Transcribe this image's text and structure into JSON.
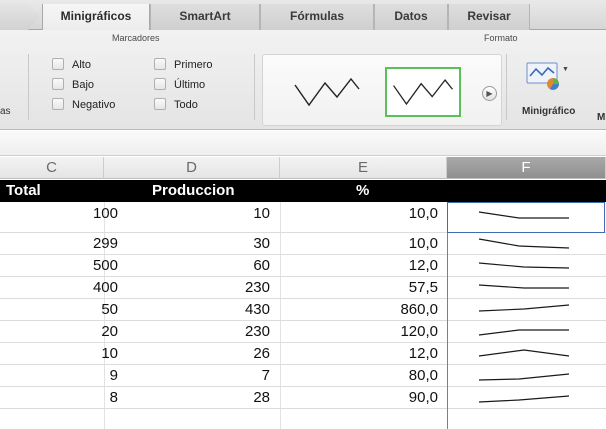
{
  "ribbon": {
    "tabs": [
      {
        "label": "Minigráficos",
        "active": true
      },
      {
        "label": "SmartArt",
        "active": false
      },
      {
        "label": "Fórmulas",
        "active": false
      },
      {
        "label": "Datos",
        "active": false
      },
      {
        "label": "Revisar",
        "active": false
      }
    ],
    "groups": {
      "markers": {
        "title": "Marcadores",
        "options": [
          {
            "label": "Alto",
            "checked": false
          },
          {
            "label": "Bajo",
            "checked": false
          },
          {
            "label": "Negativo",
            "checked": false
          },
          {
            "label": "Primero",
            "checked": false
          },
          {
            "label": "Último",
            "checked": false
          },
          {
            "label": "Todo",
            "checked": false
          }
        ]
      },
      "format": {
        "title": "Formato",
        "styles_selected_index": 1,
        "sparkline_button_label": "Minigráfico"
      }
    },
    "edge_left_fragment": "as",
    "edge_right_fragment": "M"
  },
  "sheet": {
    "columns": [
      "C",
      "D",
      "E",
      "F"
    ],
    "selected_column": "F",
    "header": {
      "total": "Total",
      "produccion": "Produccion",
      "percent": "%"
    },
    "rows": [
      {
        "total": "100",
        "produccion": "10",
        "percent": "10,0"
      },
      {
        "total": "299",
        "produccion": "30",
        "percent": "10,0"
      },
      {
        "total": "500",
        "produccion": "60",
        "percent": "12,0"
      },
      {
        "total": "400",
        "produccion": "230",
        "percent": "57,5"
      },
      {
        "total": "50",
        "produccion": "430",
        "percent": "860,0"
      },
      {
        "total": "20",
        "produccion": "230",
        "percent": "120,0"
      },
      {
        "total": "10",
        "produccion": "26",
        "percent": "12,0"
      },
      {
        "total": "9",
        "produccion": "7",
        "percent": "80,0"
      },
      {
        "total": "8",
        "produccion": "28",
        "percent": "90,0"
      }
    ]
  },
  "colors": {
    "active_style_border": "#58c258",
    "selection_border": "#3e6db5",
    "header_fill": "#000000"
  }
}
